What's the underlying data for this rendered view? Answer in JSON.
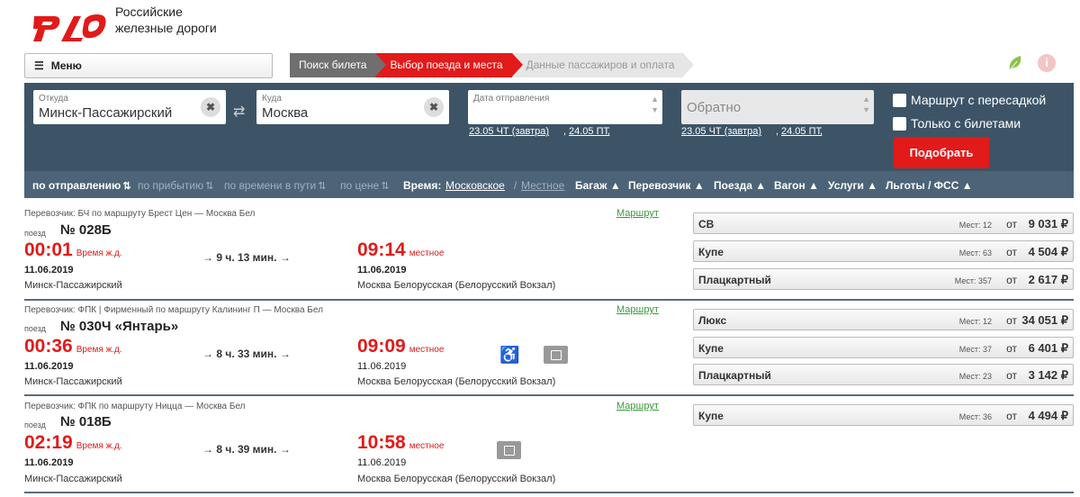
{
  "brand": {
    "line1": "Российские",
    "line2": "железные дороги"
  },
  "menu": {
    "label": "Меню"
  },
  "steps": [
    "Поиск билета",
    "Выбор поезда и места",
    "Данные пассажиров и оплата"
  ],
  "search": {
    "from_label": "Откуда",
    "from_value": "Минск-Пассажирский",
    "to_label": "Куда",
    "to_value": "Москва",
    "date_label": "Дата отправления",
    "return_placeholder": "Обратно",
    "quick_dates": {
      "d1": "23.05 ЧТ (завтра)",
      "d2": "24.05 ПТ"
    },
    "transfer_label": "Маршрут с пересадкой",
    "with_tickets_label": "Только с билетами",
    "find_label": "Подобрать"
  },
  "sort": {
    "by_departure": "по отправлению",
    "by_arrival": "по прибытию",
    "by_travel_time": "по времени в пути",
    "by_price": "по цене",
    "time_label": "Время:",
    "time_moscow": "Московское",
    "time_local": "Местное",
    "filters": [
      "Багаж",
      "Перевозчик",
      "Поезда",
      "Вагон",
      "Услуги",
      "Льготы / ФСС"
    ]
  },
  "labels": {
    "train": "поезд",
    "rail_time": "Время ж.д.",
    "local": "местное",
    "route": "Маршрут",
    "seats": "Мест:",
    "from": "от"
  },
  "trains": [
    {
      "carrier": "Перевозчик: БЧ   по маршруту Брест Цен — Москва Бел",
      "number": "№ 028Б",
      "dep_time": "00:01",
      "duration": "9 ч. 13 мин.",
      "arr_time": "09:14",
      "dep_date": "11.06.2019",
      "arr_date": "11.06.2019",
      "dep_station": "Минск-Пассажирский",
      "arr_station": "Москва Белорусская (Белорусский Вокзал)",
      "cars": [
        {
          "name": "СВ",
          "seats": "12",
          "price": "9 031 ₽"
        },
        {
          "name": "Купе",
          "seats": "63",
          "price": "4 504 ₽"
        },
        {
          "name": "Плацкартный",
          "seats": "357",
          "price": "2 617 ₽"
        }
      ]
    },
    {
      "carrier": "Перевозчик: ФПК | Фирменный    по маршруту Калининг П — Москва Бел",
      "number": "№ 030Ч «Янтарь»",
      "dep_time": "00:36",
      "duration": "8 ч. 33 мин.",
      "arr_time": "09:09",
      "dep_date": "11.06.2019",
      "arr_date": "11.06.2019",
      "dep_station": "Минск-Пассажирский",
      "arr_station": "Москва Белорусская (Белорусский Вокзал)",
      "cars": [
        {
          "name": "Люкс",
          "seats": "12",
          "price": "34 051 ₽"
        },
        {
          "name": "Купе",
          "seats": "37",
          "price": "6 401 ₽"
        },
        {
          "name": "Плацкартный",
          "seats": "23",
          "price": "3 142 ₽"
        }
      ]
    },
    {
      "carrier": "Перевозчик: ФПК    по маршруту Ницца — Москва Бел",
      "number": "№ 018Б",
      "dep_time": "02:19",
      "duration": "8 ч. 39 мин.",
      "arr_time": "10:58",
      "dep_date": "11.06.2019",
      "arr_date": "11.06.2019",
      "dep_station": "Минск-Пассажирский",
      "arr_station": "Москва Белорусская (Белорусский Вокзал)",
      "cars": [
        {
          "name": "Купе",
          "seats": "36",
          "price": "4 494 ₽"
        }
      ]
    }
  ]
}
